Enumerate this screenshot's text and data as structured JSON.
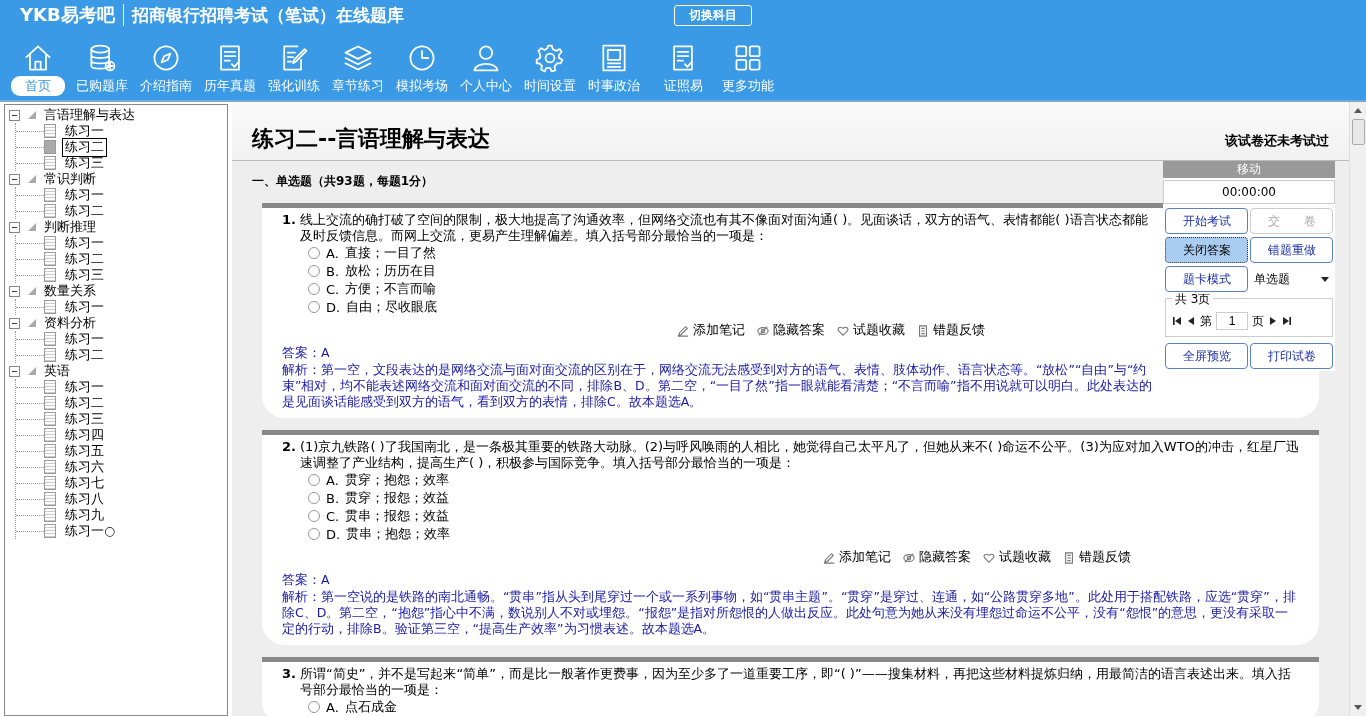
{
  "header": {
    "logo": "YKB易考吧",
    "title": "招商银行招聘考试（笔试）在线题库",
    "switch_button": "切换科目"
  },
  "nav": [
    {
      "label": "首页",
      "selected": true
    },
    {
      "label": "已购题库",
      "selected": false
    },
    {
      "label": "介绍指南",
      "selected": false
    },
    {
      "label": "历年真题",
      "selected": false
    },
    {
      "label": "强化训练",
      "selected": false
    },
    {
      "label": "章节练习",
      "selected": false
    },
    {
      "label": "模拟考场",
      "selected": false
    },
    {
      "label": "个人中心",
      "selected": false
    },
    {
      "label": "时间设置",
      "selected": false
    },
    {
      "label": "时事政治",
      "selected": false
    },
    {
      "label": "证照易",
      "selected": false
    },
    {
      "label": "更多功能",
      "selected": false
    }
  ],
  "tree": [
    {
      "label": "言语理解与表达",
      "expanded": true,
      "children": [
        {
          "label": "练习一",
          "selected": false
        },
        {
          "label": "练习二",
          "selected": true
        },
        {
          "label": "练习三",
          "selected": false
        }
      ]
    },
    {
      "label": "常识判断",
      "expanded": true,
      "children": [
        {
          "label": "练习一",
          "selected": false
        },
        {
          "label": "练习二",
          "selected": false
        }
      ]
    },
    {
      "label": "判断推理",
      "expanded": true,
      "children": [
        {
          "label": "练习一",
          "selected": false
        },
        {
          "label": "练习二",
          "selected": false
        },
        {
          "label": "练习三",
          "selected": false
        }
      ]
    },
    {
      "label": "数量关系",
      "expanded": true,
      "children": [
        {
          "label": "练习一",
          "selected": false
        }
      ]
    },
    {
      "label": "资料分析",
      "expanded": true,
      "children": [
        {
          "label": "练习一",
          "selected": false
        },
        {
          "label": "练习二",
          "selected": false
        }
      ]
    },
    {
      "label": "英语",
      "expanded": true,
      "children": [
        {
          "label": "练习一",
          "selected": false
        },
        {
          "label": "练习二",
          "selected": false
        },
        {
          "label": "练习三",
          "selected": false
        },
        {
          "label": "练习四",
          "selected": false
        },
        {
          "label": "练习五",
          "selected": false
        },
        {
          "label": "练习六",
          "selected": false
        },
        {
          "label": "练习七",
          "selected": false
        },
        {
          "label": "练习八",
          "selected": false
        },
        {
          "label": "练习九",
          "selected": false
        },
        {
          "label": "练习一○",
          "selected": false
        }
      ]
    }
  ],
  "paper": {
    "title": "练习二--言语理解与表达",
    "status": "该试卷还未考试过",
    "section": "一、单选题（共93题，每题1分）"
  },
  "questions": [
    {
      "number": "1.",
      "text": "线上交流的确打破了空间的限制，极大地提高了沟通效率，但网络交流也有其不像面对面沟通( )。见面谈话，双方的语气、表情都能( )语言状态都能及时反馈信息。而网上交流，更易产生理解偏差。填入括号部分最恰当的一项是：",
      "options": [
        {
          "label": "A.",
          "text": "直接；一目了然",
          "selected": false
        },
        {
          "label": "B.",
          "text": "放松；历历在目",
          "selected": false
        },
        {
          "label": "C.",
          "text": "方便；不言而喻",
          "selected": false
        },
        {
          "label": "D.",
          "text": "自由；尽收眼底",
          "selected": false
        }
      ],
      "actions": [
        "添加笔记",
        "隐藏答案",
        "试题收藏",
        "错题反馈"
      ],
      "answer_label": "答案：",
      "answer": "A",
      "analysis": "解析：第一空，文段表达的是网络交流与面对面交流的区别在于，网络交流无法感受到对方的语气、表情、肢体动作、语言状态等。“放松”“自由”与“约束”相对，均不能表述网络交流和面对面交流的不同，排除B、D。第二空，“一目了然”指一眼就能看清楚；“不言而喻”指不用说就可以明白。此处表达的是见面谈话能感受到双方的语气，看到双方的表情，排除C。故本题选A。"
    },
    {
      "number": "2.",
      "text": "(1)京九铁路( )了我国南北，是一条极其重要的铁路大动脉。(2)与呼风唤雨的人相比，她觉得自己太平凡了，但她从来不( )命运不公平。(3)为应对加入WTO的冲击，红星厂迅速调整了产业结构，提高生产( )，积极参与国际竞争。填入括号部分最恰当的一项是：",
      "options": [
        {
          "label": "A.",
          "text": "贯穿；抱怨；效率",
          "selected": false
        },
        {
          "label": "B.",
          "text": "贯穿；报怨；效益",
          "selected": false
        },
        {
          "label": "C.",
          "text": "贯串；报怨；效益",
          "selected": false
        },
        {
          "label": "D.",
          "text": "贯串；抱怨；效率",
          "selected": false
        }
      ],
      "actions": [
        "添加笔记",
        "隐藏答案",
        "试题收藏",
        "错题反馈"
      ],
      "answer_label": "答案：",
      "answer": "A",
      "analysis": "解析：第一空说的是铁路的南北通畅。“贯串”指从头到尾穿过一个或一系列事物，如“贯串主题”。“贯穿”是穿过、连通，如“公路贯穿多地”。此处用于搭配铁路，应选“贯穿”，排除C、D。第二空，“抱怨”指心中不满，数说别人不对或埋怨。“报怨”是指对所怨恨的人做出反应。此处句意为她从来没有埋怨过命运不公平，没有“怨恨”的意思，更没有采取一定的行动，排除B。验证第三空，“提高生产效率”为习惯表述。故本题选A。"
    },
    {
      "number": "3.",
      "text": "所谓“简史”，并不是写起来“简单”，而是比一般著作更费事，因为至少多了一道重要工序，即“( )”——搜集材料，再把这些材料提炼归纳，用最简洁的语言表述出来。填入括号部分最恰当的一项是：",
      "options": [
        {
          "label": "A.",
          "text": "点石成金",
          "selected": false
        }
      ]
    }
  ],
  "panel": {
    "title": "移动",
    "timer": "00:00:00",
    "buttons": [
      {
        "label": "开始考试",
        "disabled": false,
        "selected": false
      },
      {
        "label": "交　　卷",
        "disabled": true,
        "selected": false
      },
      {
        "label": "关闭答案",
        "disabled": false,
        "selected": true
      },
      {
        "label": "错题重做",
        "disabled": false,
        "selected": false
      },
      {
        "label": "题卡模式",
        "disabled": false,
        "selected": false
      }
    ],
    "type_select": "单选题",
    "pages_label": "共 3页",
    "page_prefix": "第",
    "page": "1",
    "page_suffix": "页",
    "bottom_buttons": [
      {
        "label": "全屏预览",
        "disabled": false,
        "selected": false
      },
      {
        "label": "打印试卷",
        "disabled": false,
        "selected": false
      }
    ]
  }
}
